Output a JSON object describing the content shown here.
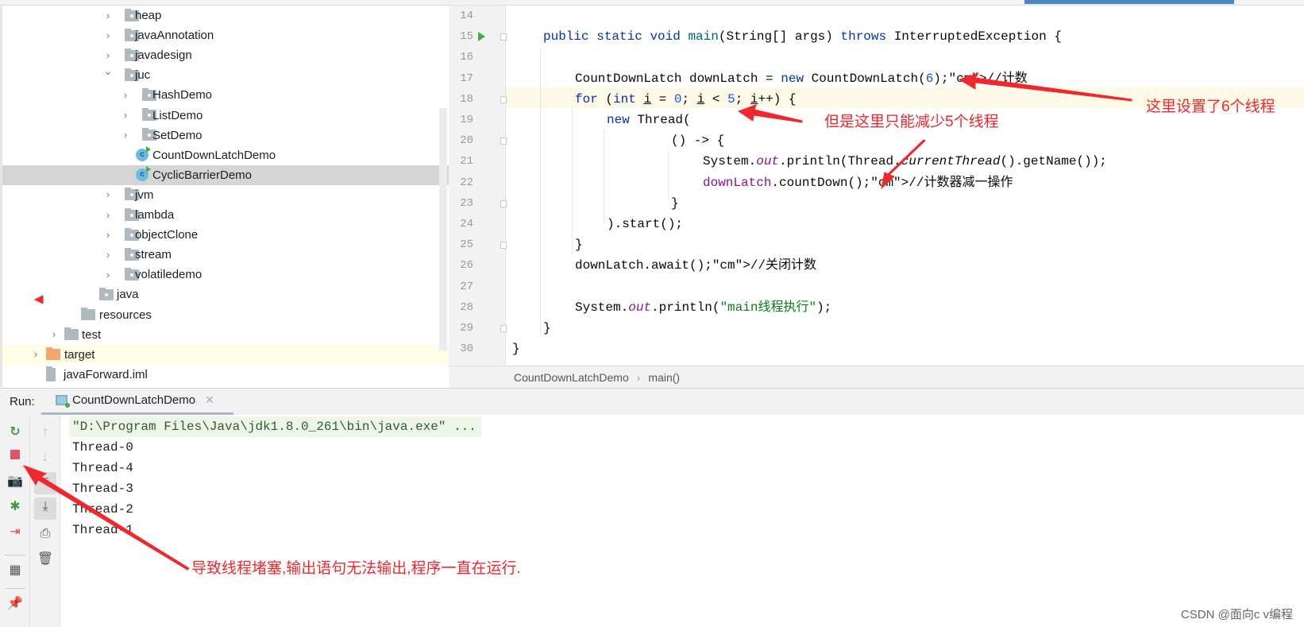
{
  "tree": {
    "items": [
      {
        "label": "heap",
        "type": "package",
        "expanded": false
      },
      {
        "label": "javaAnnotation",
        "type": "package",
        "expanded": false
      },
      {
        "label": "javadesign",
        "type": "package",
        "expanded": false
      },
      {
        "label": "juc",
        "type": "package",
        "expanded": true
      },
      {
        "label": "HashDemo",
        "type": "package",
        "expanded": false
      },
      {
        "label": "ListDemo",
        "type": "package",
        "expanded": false
      },
      {
        "label": "SetDemo",
        "type": "package",
        "expanded": false
      },
      {
        "label": "CountDownLatchDemo",
        "type": "class"
      },
      {
        "label": "CyclicBarrierDemo",
        "type": "class",
        "selected": true
      },
      {
        "label": "jvm",
        "type": "package",
        "expanded": false
      },
      {
        "label": "lambda",
        "type": "package",
        "expanded": false
      },
      {
        "label": "objectClone",
        "type": "package",
        "expanded": false
      },
      {
        "label": "stream",
        "type": "package",
        "expanded": false
      },
      {
        "label": "volatiledemo",
        "type": "package",
        "expanded": false
      },
      {
        "label": "java",
        "type": "source-root"
      },
      {
        "label": "resources",
        "type": "resources-root"
      },
      {
        "label": "test",
        "type": "folder",
        "expanded": false
      },
      {
        "label": "target",
        "type": "excluded-folder",
        "expanded": false
      },
      {
        "label": "javaForward.iml",
        "type": "module-file"
      }
    ]
  },
  "editor": {
    "line_numbers": [
      "14",
      "15",
      "16",
      "17",
      "18",
      "19",
      "20",
      "21",
      "22",
      "23",
      "24",
      "25",
      "26",
      "27",
      "28",
      "29",
      "30"
    ],
    "lines": [
      "",
      "public static void main(String[] args) throws InterruptedException {",
      "",
      "CountDownLatch downLatch = new CountDownLatch(6);//计数",
      "for (int i = 0; i < 5; i++) {",
      "new Thread(",
      "() -> {",
      "System.out.println(Thread.currentThread().getName());",
      "downLatch.countDown();//计数器减一操作",
      "}",
      ").start();",
      "}",
      "downLatch.await();//关闭计数",
      "",
      "System.out.println(\"main线程执行\");",
      "}",
      "}"
    ],
    "current_line": "18",
    "breadcrumb": [
      "CountDownLatchDemo",
      "main()"
    ]
  },
  "run": {
    "label": "Run:",
    "tab": "CountDownLatchDemo",
    "output": [
      "\"D:\\Program Files\\Java\\jdk1.8.0_261\\bin\\java.exe\" ...",
      "Thread-0",
      "Thread-4",
      "Thread-3",
      "Thread-2",
      "Thread-1"
    ]
  },
  "annotations": {
    "a1": "这里设置了6个线程",
    "a2": "但是这里只能减少5个线程",
    "a3": "导致线程堵塞,输出语句无法输出,程序一直在运行.",
    "color": "#f0282d"
  },
  "watermark": "CSDN @面向c v编程",
  "colors": {
    "keyword": "#0033b3",
    "number": "#1750eb",
    "comment": "#8c8c8c",
    "string": "#067d17",
    "field": "#871094"
  }
}
